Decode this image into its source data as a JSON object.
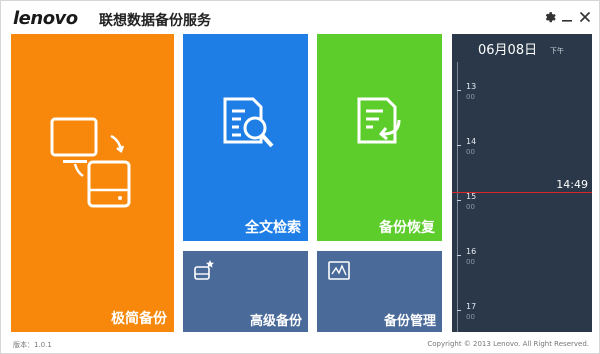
{
  "title_bar": {
    "logo": "lenovo",
    "app_title": "联想数据备份服务",
    "settings_icon": "gear-icon",
    "minimize_icon": "minimize-icon",
    "close_icon": "close-icon"
  },
  "tiles": {
    "simple_backup": {
      "label": "极简备份",
      "icon": "computer-drive-sync-icon",
      "color": "#f7880b"
    },
    "full_text_search": {
      "label": "全文检索",
      "icon": "document-search-icon",
      "color": "#1f7ee6"
    },
    "backup_restore": {
      "label": "备份恢复",
      "icon": "document-restore-icon",
      "color": "#5ccd2b"
    },
    "advanced_backup": {
      "label": "高级备份",
      "icon": "drive-star-icon",
      "color": "#4a6a9a"
    },
    "backup_manage": {
      "label": "备份管理",
      "icon": "chart-monitor-icon",
      "color": "#4a6a9a"
    }
  },
  "timeline": {
    "date": "06月08日",
    "ampm": "下午",
    "hours": [
      {
        "hour": "13",
        "min": "00"
      },
      {
        "hour": "14",
        "min": "00"
      },
      {
        "hour": "15",
        "min": "00"
      },
      {
        "hour": "16",
        "min": "00"
      },
      {
        "hour": "17",
        "min": "00"
      }
    ],
    "current_time": "14:49",
    "now_color": "#d9262b"
  },
  "footer": {
    "version": "版本：1.0.1",
    "copyright": "Copyright © 2013 Lenovo. All Right Reserved."
  }
}
